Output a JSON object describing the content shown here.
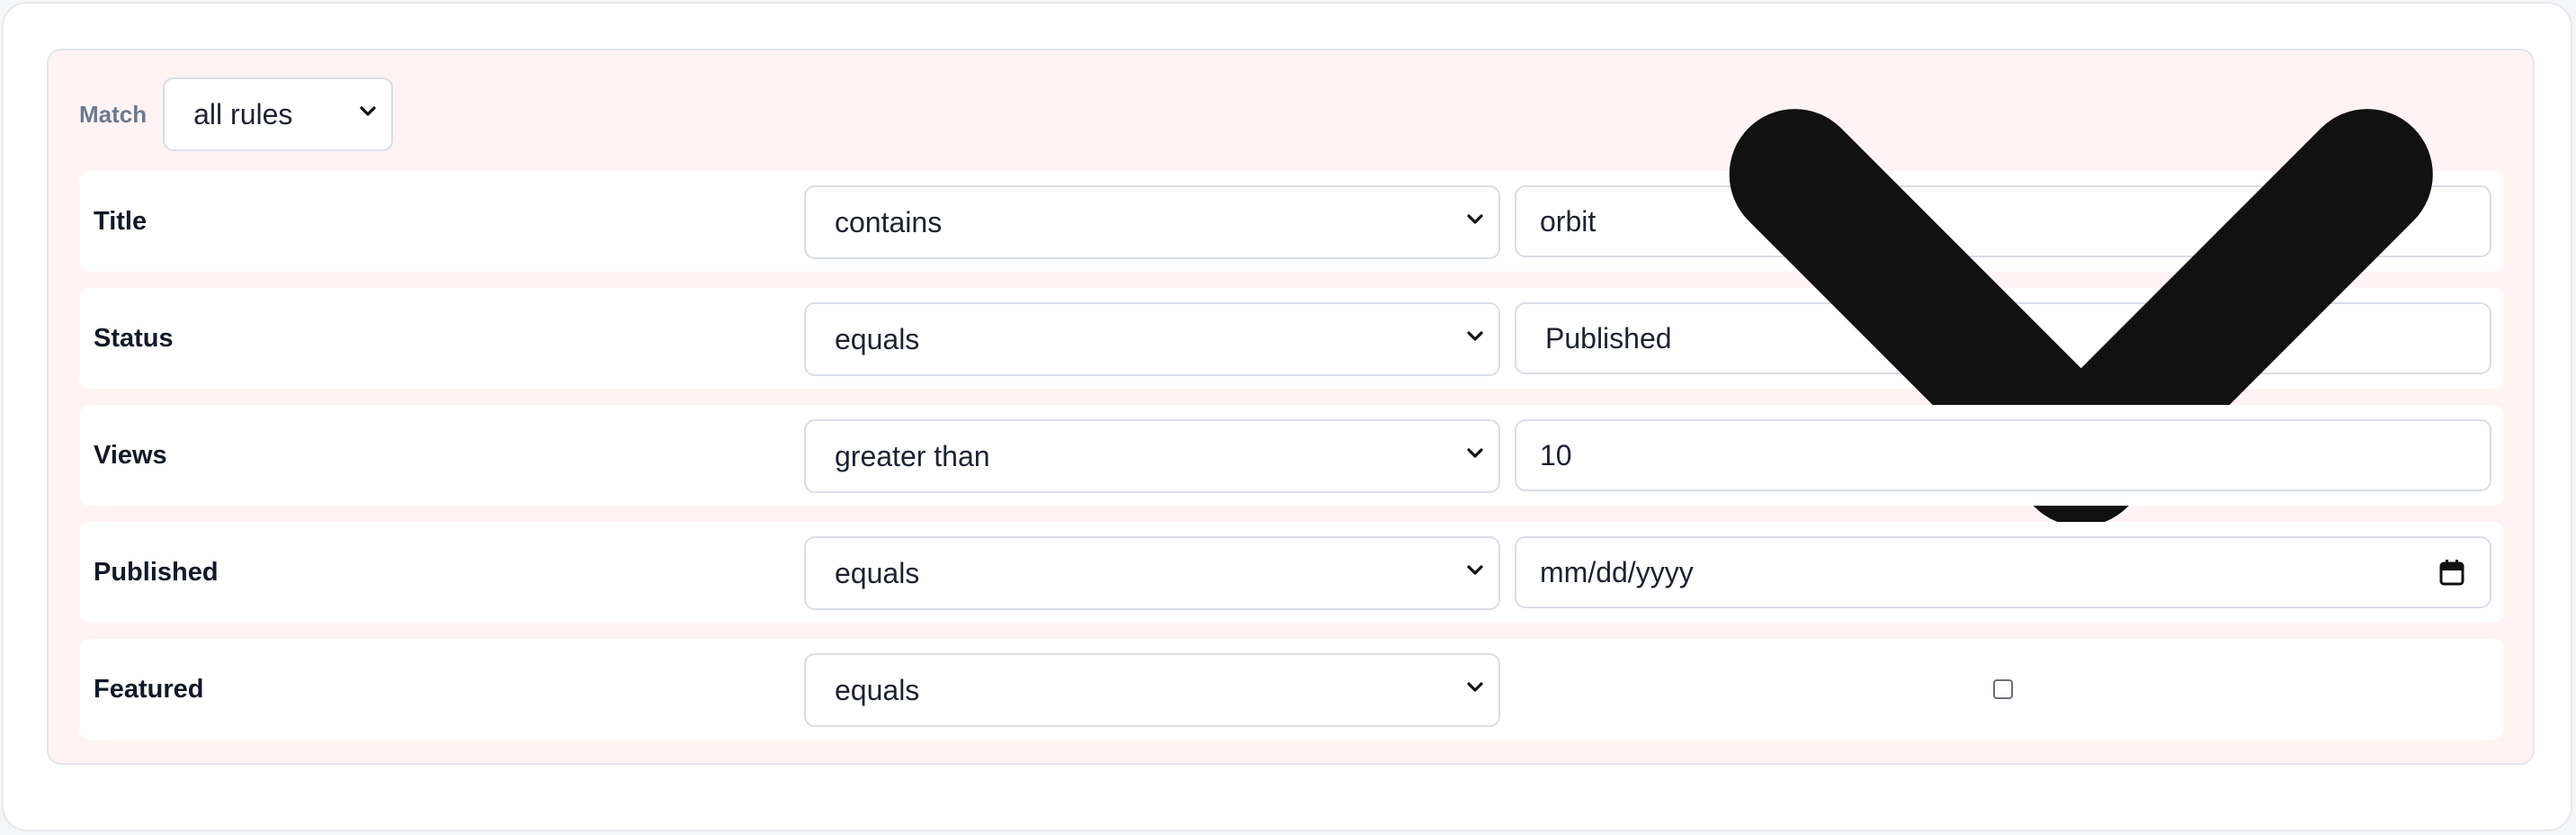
{
  "match": {
    "label": "Match",
    "selected": "all rules"
  },
  "rules": [
    {
      "field": "Title",
      "operator": "contains",
      "value": "orbit",
      "value_type": "text"
    },
    {
      "field": "Status",
      "operator": "equals",
      "value": "Published",
      "value_type": "select"
    },
    {
      "field": "Views",
      "operator": "greater than",
      "value": "10",
      "value_type": "number"
    },
    {
      "field": "Published",
      "operator": "equals",
      "value": "mm/dd/yyyy",
      "value_type": "date"
    },
    {
      "field": "Featured",
      "operator": "equals",
      "value": false,
      "value_type": "checkbox"
    }
  ],
  "icons": {
    "dropdown": "chevron-down-icon",
    "date": "calendar-icon"
  },
  "colors": {
    "group_background": "#fff4f3",
    "label_muted": "#6b7a90",
    "border": "#d9dee6"
  }
}
